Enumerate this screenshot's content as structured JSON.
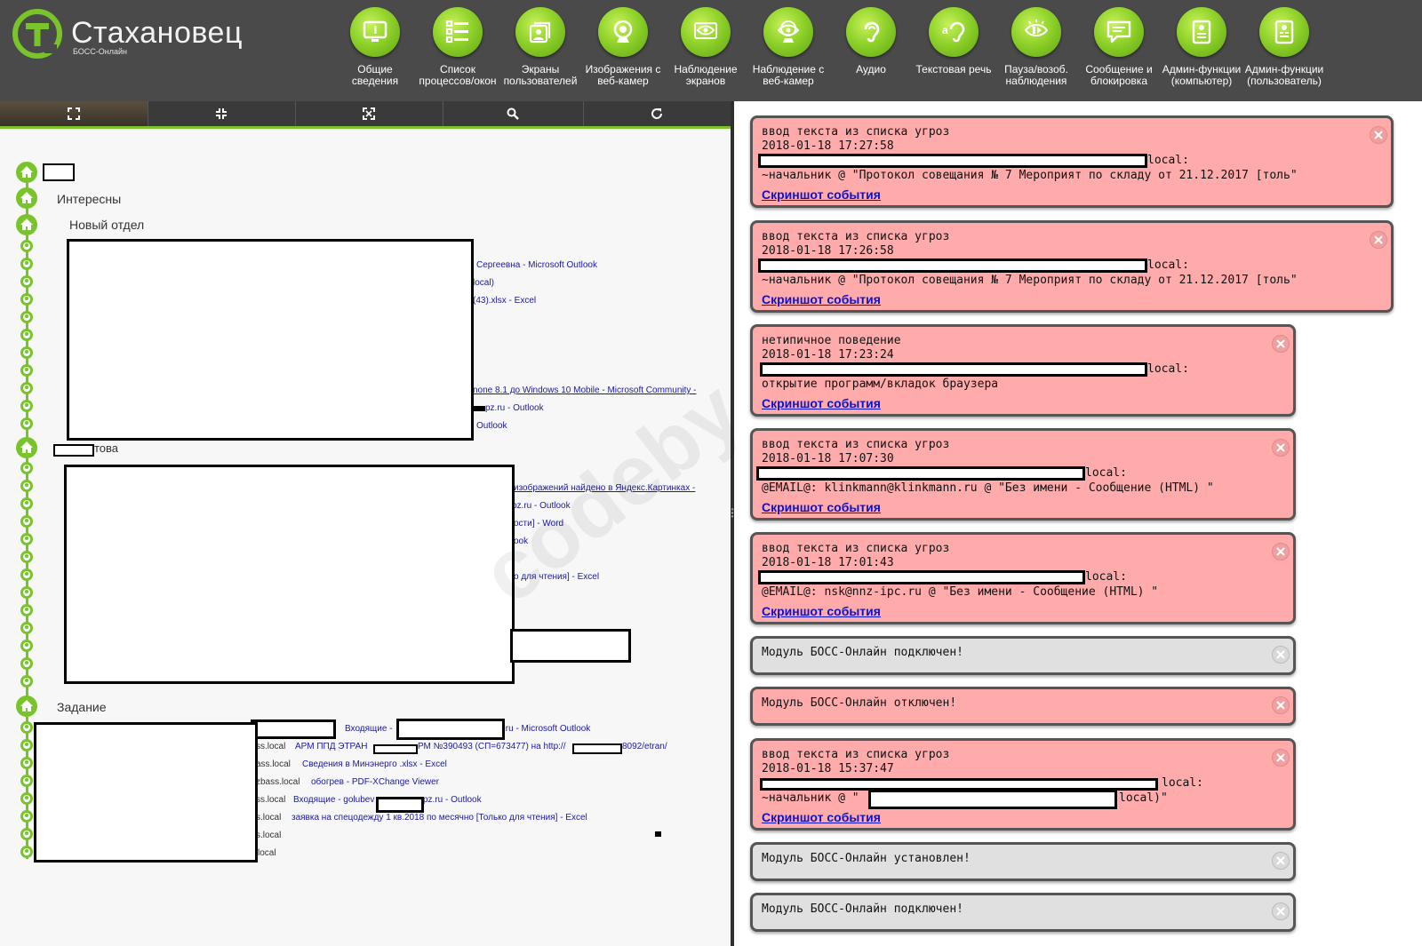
{
  "app": {
    "title": "Стахановец",
    "subtitle": "БОСС-Онлайн"
  },
  "nav": [
    {
      "label": "Общие сведения",
      "icon": "info-monitor-icon"
    },
    {
      "label": "Список процессов/окон",
      "icon": "list-icon"
    },
    {
      "label": "Экраны пользователей",
      "icon": "screens-icon"
    },
    {
      "label": "Изображения с веб-камер",
      "icon": "webcam-icon"
    },
    {
      "label": "Наблюдение экранов",
      "icon": "eye-screen-icon"
    },
    {
      "label": "Наблюдение с веб-камер",
      "icon": "eye-webcam-icon"
    },
    {
      "label": "Аудио",
      "icon": "ear-icon"
    },
    {
      "label": "Текстовая речь",
      "icon": "speech-ear-icon"
    },
    {
      "label": "Пауза/возоб. наблюдения",
      "icon": "pause-eye-icon"
    },
    {
      "label": "Сообщение и блокировка",
      "icon": "message-icon"
    },
    {
      "label": "Админ-функции (компьютер)",
      "icon": "admin-computer-icon"
    },
    {
      "label": "Админ-функции (пользователь)",
      "icon": "admin-user-icon"
    }
  ],
  "toolbar": [
    {
      "icon": "expand-icon"
    },
    {
      "icon": "collapse-icon"
    },
    {
      "icon": "fullscreen-icon"
    },
    {
      "icon": "search-icon"
    },
    {
      "icon": "refresh-icon"
    }
  ],
  "tree": {
    "groups": [
      {
        "label": "Интересны"
      },
      {
        "label": "Новый отдел"
      },
      {
        "label": "това"
      },
      {
        "label": "Задание"
      }
    ],
    "group1_windows": [
      "Сергеевна - Microsoft Outlook",
      "local)",
      "(43).xlsx - Excel",
      "none 8.1 до Windows 10 Mobile - Microsoft Community -",
      "pz.ru - Outlook",
      "Outlook"
    ],
    "group2_windows": [
      "изображений найдено в Яндекс.Картинках - ",
      "pz.ru - Outlook",
      "ости] - Word",
      "ook",
      "о для чтения] - Excel"
    ],
    "group3_rows": [
      {
        "host": "",
        "title": "Входящие - ",
        "tail": ".ru - Microsoft Outlook"
      },
      {
        "host": "ss.local",
        "title": "АРМ ППД ЭТРАН",
        "tail": "РМ №390493 (СП=673477) на http://",
        "tail2": "8092/etran/"
      },
      {
        "host": "ass.local",
        "title": "Сведения в Минэнерго .xlsx - Excel",
        "tail": ""
      },
      {
        "host": "zbass.local",
        "title": "обогрев - PDF-XChange Viewer",
        "tail": ""
      },
      {
        "host": "ss.local",
        "title": "Входящие - golubev",
        "tail": "pz.ru - Outlook"
      },
      {
        "host": "s.local",
        "title": "заявка на спецодежду 1 кв.2018 по месячно [Только для чтения] - Excel",
        "tail": ""
      },
      {
        "host": "s.local",
        "title": "",
        "tail": ""
      },
      {
        "host": "local",
        "title": "",
        "tail": ""
      }
    ]
  },
  "events": [
    {
      "type": "ввод текста из списка угроз",
      "time": "2018-01-18 17:27:58",
      "host": "local:",
      "text": "~начальник @ \"Протокол совещания № 7 Мероприят по складу от  21.12.2017 [толь\"",
      "link": "Скриншот события"
    },
    {
      "type": "ввод текста из списка угроз",
      "time": "2018-01-18 17:26:58",
      "host": "local:",
      "text": "~начальник @ \"Протокол совещания № 7 Мероприят по складу от  21.12.2017 [толь\"",
      "link": "Скриншот события"
    },
    {
      "type": "нетипичное поведение",
      "time": "2018-01-18 17:23:24",
      "host": "local:",
      "text": "открытие программ/вкладок браузера",
      "link": "Скриншот события"
    },
    {
      "type": "ввод текста из списка угроз",
      "time": "2018-01-18 17:07:30",
      "host": "local:",
      "text": "@EMAIL@: klinkmann@klinkmann.ru @ \"Без имени - Сообщение (HTML) \"",
      "link": "Скриншот события"
    },
    {
      "type": "ввод текста из списка угроз",
      "time": "2018-01-18 17:01:43",
      "host": "local:",
      "text": "@EMAIL@: nsk@nnz-ipc.ru @ \"Без имени - Сообщение (HTML) \"",
      "link": "Скриншот события"
    },
    {
      "type": "Модуль БОСС-Онлайн подключен!"
    },
    {
      "type": "Модуль БОСС-Онлайн отключен!"
    },
    {
      "type": "ввод текста из списка угроз",
      "time": "2018-01-18 15:37:47",
      "host": "local:",
      "text": "~начальник @ \"",
      "text_tail": "local)\"",
      "link": "Скриншот события"
    },
    {
      "type": "Модуль БОСС-Онлайн установлен!"
    },
    {
      "type": "Модуль БОСС-Онлайн подключен!"
    }
  ],
  "watermark": "codeby",
  "colors": {
    "accent": "#78c42a",
    "header": "#4a4a4a",
    "alert": "#ffabab",
    "info": "#e0e0e0",
    "link": "#0d13c9"
  }
}
